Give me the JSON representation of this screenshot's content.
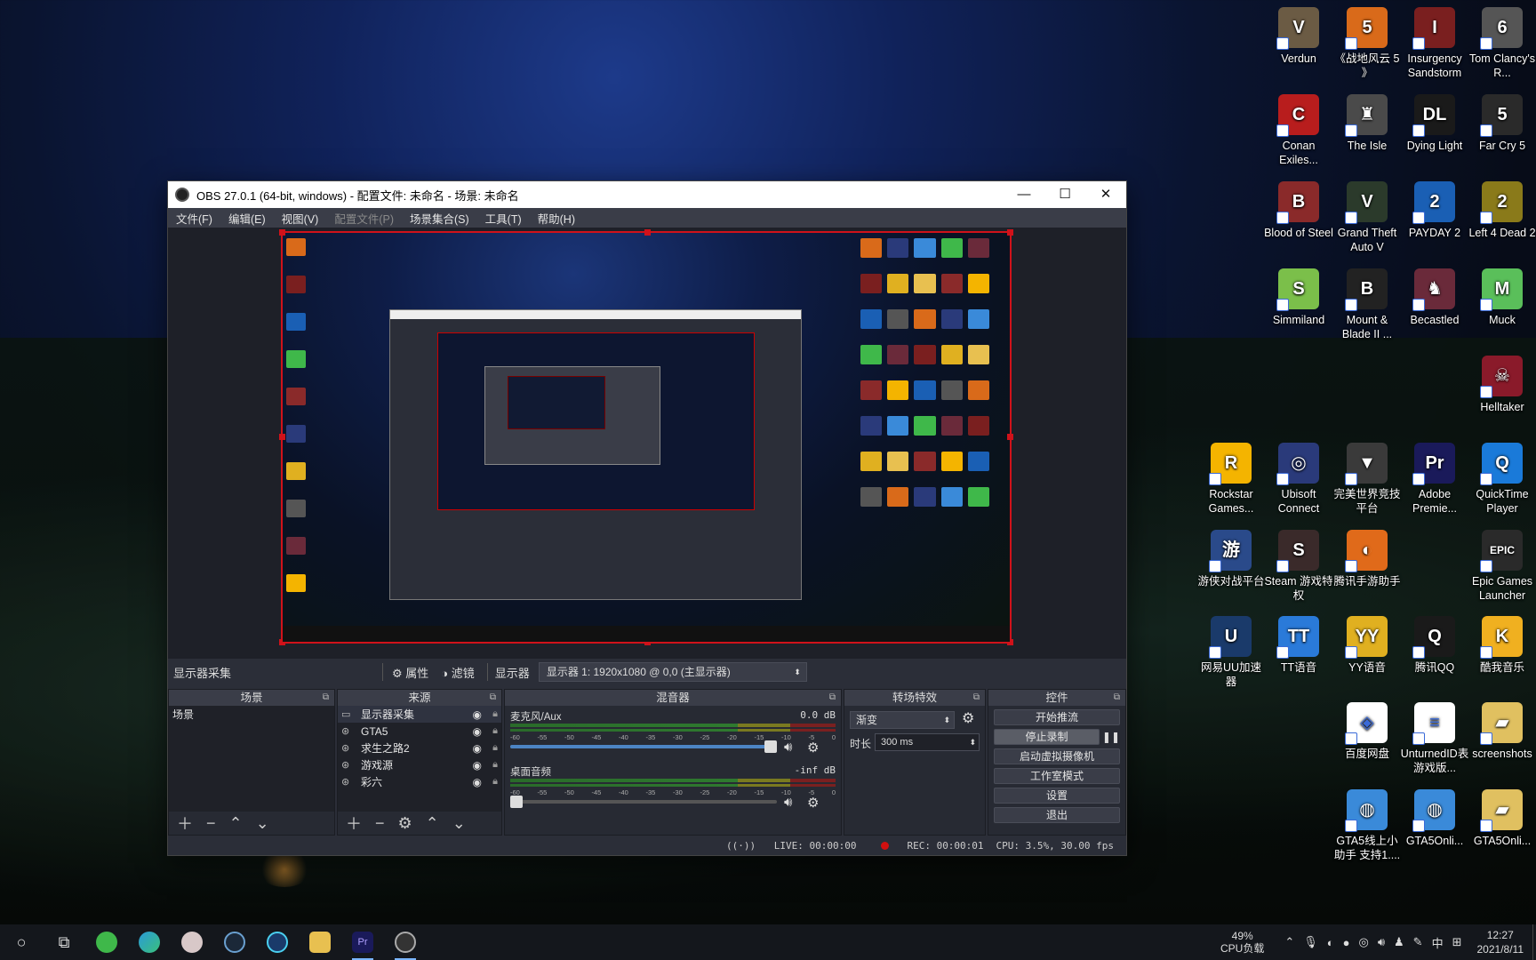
{
  "colors": {
    "obs_bg": "#2b2e38",
    "selection_red": "#d0121a",
    "accent_blue": "#4c84c4"
  },
  "desktop_icons": [
    {
      "label": "Verdun",
      "icon": "verdun-icon",
      "bg": "#6b5b44",
      "glyph": "V"
    },
    {
      "label": "《战地风云 5 》",
      "icon": "battlefield5-icon",
      "bg": "#d96a1a",
      "glyph": "5"
    },
    {
      "label": "Insurgency Sandstorm",
      "icon": "insurgency-icon",
      "bg": "#7a1f1f",
      "glyph": "I"
    },
    {
      "label": "Tom Clancy's R...",
      "icon": "rainbow-six-icon",
      "bg": "#555555",
      "glyph": "6"
    },
    {
      "label": "Conan Exiles...",
      "icon": "conan-icon",
      "bg": "#b81d1d",
      "glyph": "C"
    },
    {
      "label": "The Isle",
      "icon": "the-isle-icon",
      "bg": "#4a4a4a",
      "glyph": "♜"
    },
    {
      "label": "Dying Light",
      "icon": "dying-light-icon",
      "bg": "#1a1a1a",
      "glyph": "DL"
    },
    {
      "label": "Far Cry 5",
      "icon": "far-cry-5-icon",
      "bg": "#2a2a2a",
      "glyph": "5"
    },
    {
      "label": "Blood of Steel",
      "icon": "blood-of-steel-icon",
      "bg": "#8a2a2a",
      "glyph": "B"
    },
    {
      "label": "Grand Theft Auto V",
      "icon": "gta5-icon",
      "bg": "#2b3a2b",
      "glyph": "V"
    },
    {
      "label": "PAYDAY 2",
      "icon": "payday2-icon",
      "bg": "#1a5fb4",
      "glyph": "2"
    },
    {
      "label": "Left 4 Dead 2",
      "icon": "l4d2-icon",
      "bg": "#8a7a1a",
      "glyph": "2"
    },
    {
      "label": "Simmiland",
      "icon": "simmiland-icon",
      "bg": "#7bbf4a",
      "glyph": "S"
    },
    {
      "label": "Mount & Blade II ...",
      "icon": "mount-blade-icon",
      "bg": "#222222",
      "glyph": "B"
    },
    {
      "label": "Becastled",
      "icon": "becastled-icon",
      "bg": "#6a2a3a",
      "glyph": "♞"
    },
    {
      "label": "Muck",
      "icon": "muck-icon",
      "bg": "#5abf5a",
      "glyph": "M"
    },
    {
      "label": "Helltaker",
      "icon": "helltaker-icon",
      "bg": "#8a1a2a",
      "glyph": "☠"
    },
    {
      "label": "Rockstar Games...",
      "icon": "rockstar-icon",
      "bg": "#f4b400",
      "glyph": "R"
    },
    {
      "label": "Ubisoft Connect",
      "icon": "ubisoft-icon",
      "bg": "#2a3a7a",
      "glyph": "◎"
    },
    {
      "label": "完美世界竞技平台",
      "icon": "perfect-world-icon",
      "bg": "#3a3a3a",
      "glyph": "▼"
    },
    {
      "label": "Adobe Premie...",
      "icon": "premiere-icon",
      "bg": "#1a1a5a",
      "glyph": "Pr"
    },
    {
      "label": "QuickTime Player",
      "icon": "quicktime-icon",
      "bg": "#1a7ad9",
      "glyph": "Q"
    },
    {
      "label": "游侠对战平台",
      "icon": "youxia-icon",
      "bg": "#2a4a8a",
      "glyph": "游"
    },
    {
      "label": "Steam 游戏特权",
      "icon": "steam-privilege-icon",
      "bg": "#3a2a2a",
      "glyph": "S"
    },
    {
      "label": "腾讯手游助手",
      "icon": "tencent-mobile-icon",
      "bg": "#e06a1a",
      "glyph": "◐"
    },
    {
      "label": "Epic Games Launcher",
      "icon": "epic-icon",
      "bg": "#2a2a2a",
      "glyph": "EPIC"
    },
    {
      "label": "网易UU加速器",
      "icon": "uu-icon",
      "bg": "#1a3a6a",
      "glyph": "U"
    },
    {
      "label": "TT语音",
      "icon": "tt-icon",
      "bg": "#2a7ad9",
      "glyph": "TT"
    },
    {
      "label": "YY语音",
      "icon": "yy-icon",
      "bg": "#e0b020",
      "glyph": "YY"
    },
    {
      "label": "腾讯QQ",
      "icon": "qq-icon",
      "bg": "#1a1a1a",
      "glyph": "Q"
    },
    {
      "label": "酷我音乐",
      "icon": "kuwo-icon",
      "bg": "#f0b020",
      "glyph": "K"
    },
    {
      "label": "百度网盘",
      "icon": "baidu-pan-icon",
      "bg": "#ffffff",
      "glyph": "◈"
    },
    {
      "label": "UnturnedID表 游戏版...",
      "icon": "document-icon",
      "bg": "#ffffff",
      "glyph": "≡"
    },
    {
      "label": "screenshots",
      "icon": "folder-icon",
      "bg": "#e0c060",
      "glyph": "▰"
    },
    {
      "label": "GTA5线上小助手 支持1....",
      "icon": "github-icon",
      "bg": "#3a8ad9",
      "glyph": "◍"
    },
    {
      "label": "GTA5Onli...",
      "icon": "github-icon",
      "bg": "#3a8ad9",
      "glyph": "◍"
    },
    {
      "label": "GTA5Onli...",
      "icon": "folder-icon",
      "bg": "#e0c060",
      "glyph": "▰"
    }
  ],
  "obs": {
    "title": "OBS 27.0.1 (64-bit, windows) - 配置文件: 未命名 - 场景: 未命名",
    "menu": [
      "文件(F)",
      "编辑(E)",
      "视图(V)",
      "配置文件(P)",
      "场景集合(S)",
      "工具(T)",
      "帮助(H)"
    ],
    "source_bar": {
      "current_source": "显示器采集",
      "properties": "属性",
      "filters": "滤镜",
      "display_label": "显示器",
      "display_value": "显示器 1: 1920x1080 @ 0,0 (主显示器)"
    },
    "docks": {
      "scenes": {
        "title": "场景",
        "items": [
          "场景"
        ]
      },
      "sources": {
        "title": "来源",
        "items": [
          "显示器采集",
          "GTA5",
          "求生之路2",
          "游戏源",
          "彩六"
        ]
      },
      "mixer": {
        "title": "混音器",
        "channels": [
          {
            "name": "麦克风/Aux",
            "db": "0.0 dB",
            "volume": 1.0
          },
          {
            "name": "桌面音频",
            "db": "-inf dB",
            "volume": 0.0
          }
        ],
        "scale": [
          "-60",
          "-55",
          "-50",
          "-45",
          "-40",
          "-35",
          "-30",
          "-25",
          "-20",
          "-15",
          "-10",
          "-5",
          "0"
        ]
      },
      "transitions": {
        "title": "转场特效",
        "type": "渐变",
        "duration_label": "时长",
        "duration": "300 ms"
      },
      "controls": {
        "title": "控件",
        "buttons": [
          "开始推流",
          "停止录制",
          "启动虚拟摄像机",
          "工作室模式",
          "设置",
          "退出"
        ]
      }
    },
    "status": {
      "live": "LIVE: 00:00:00",
      "rec": "REC: 00:00:01",
      "cpu": "CPU: 3.5%, 30.00 fps"
    }
  },
  "taskbar": {
    "apps": [
      "start-icon",
      "task-view-icon",
      "wechat-icon",
      "edge-icon",
      "app-icon",
      "steam-icon",
      "uu-icon",
      "explorer-icon",
      "premiere-icon",
      "obs-icon"
    ],
    "cpu_percent": "49%",
    "cpu_label": "CPU负载",
    "ime": "中",
    "time": "12:27",
    "date": "2021/8/11"
  }
}
